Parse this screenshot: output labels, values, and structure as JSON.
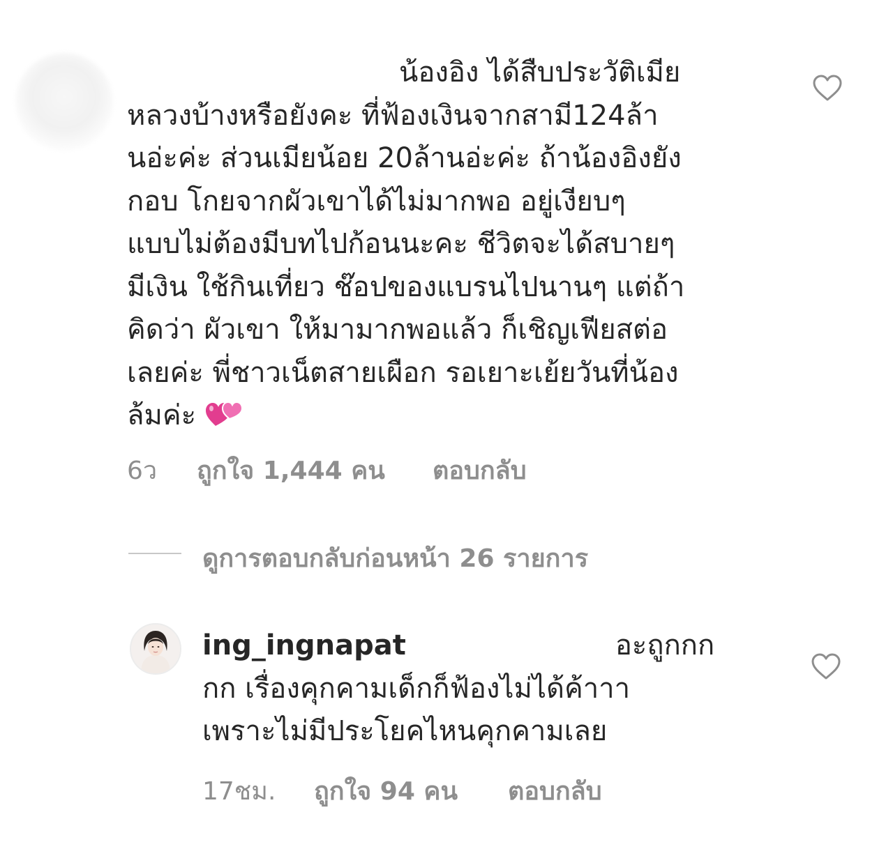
{
  "comments": [
    {
      "username": "",
      "text_lines": [
        "น้องอิง ได้สืบประวัติเมีย",
        "หลวงบ้างหรือยังคะ ที่ฟ้องเงินจากสามี124ล้า",
        "นอ่ะค่ะ ส่วนเมียน้อย 20ล้านอ่ะค่ะ ถ้าน้องอิงยัง",
        "กอบ โกยจากผัวเขาได้ไม่มากพอ อยู่เงียบๆ",
        "แบบไม่ต้องมีบทไปก้อนนะคะ ชีวิตจะได้สบายๆ",
        "มีเงิน ใช้กินเที่ยว ช๊อปของแบรนไปนานๆ แต่ถ้า",
        "คิดว่า ผัวเขา ให้มามากพอแล้ว ก็เชิญเฟียสต่อ",
        "เลยค่ะ พี่ชาวเน็ตสายเผือก รอเยาะเย้ยวันที่น้อง",
        "ล้มค่ะ"
      ],
      "emoji": "💞",
      "time": "6ว",
      "likes": "ถูกใจ 1,444 คน",
      "reply_label": "ตอบกลับ",
      "heart_icon": "heart-outline-icon"
    },
    {
      "username": "ing_ingnapat",
      "text_lines": [
        "อะถูกกก",
        "กก เรื่องคุกคามเด็กก็ฟ้องไม่ได้ค้าาา",
        "เพราะไม่มีประโยคไหนคุกคามเลย"
      ],
      "time": "17ชม.",
      "likes": "ถูกใจ 94 คน",
      "reply_label": "ตอบกลับ",
      "heart_icon": "heart-outline-icon"
    }
  ],
  "view_previous_replies": "ดูการตอบกลับก่อนหน้า 26 รายการ",
  "colors": {
    "text": "#262626",
    "meta": "#8e8e8e",
    "divider": "#c7c7c7",
    "emoji_pink": "#e23d8f"
  }
}
